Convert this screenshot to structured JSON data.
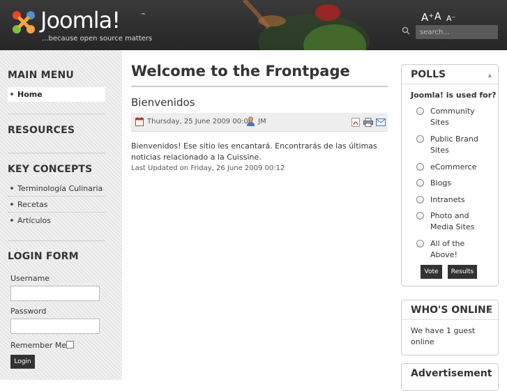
{
  "header": {
    "logo_text": "Joomla!",
    "logo_tm": "™",
    "tagline": "...because open source matters",
    "font_bigger": "A⁺",
    "font_reset": "A",
    "font_smaller": "A⁻",
    "search_placeholder": "search..."
  },
  "sidebar": {
    "main_menu": {
      "title": "MAIN MENU",
      "items": [
        {
          "label": "Home",
          "active": true
        }
      ]
    },
    "resources": {
      "title": "RESOURCES"
    },
    "key_concepts": {
      "title": "KEY CONCEPTS",
      "items": [
        {
          "label": "Terminología Culinaria"
        },
        {
          "label": "Recetas"
        },
        {
          "label": "Artículos"
        }
      ]
    },
    "login_form": {
      "title": "LOGIN FORM",
      "username_label": "Username",
      "username_value": "",
      "password_label": "Password",
      "password_value": "",
      "remember_label": "Remember Me",
      "remember_checked": false,
      "login_label": "Login"
    }
  },
  "main": {
    "page_title": "Welcome to the Frontpage",
    "article": {
      "title": "Bienvenidos",
      "date": "Thursday, 25 June 2009 00:00",
      "author": "JM",
      "body": "Bienvenidos! Ese sitio les encantará.  Encontrarás de las últimas noticias relacionado a la Cuissine.",
      "last_updated": "Last Updated on Friday, 26 June 2009 00:12"
    }
  },
  "right": {
    "polls": {
      "title": "POLLS",
      "toggle": "▲",
      "question": "Joomla! is used for?",
      "options": [
        {
          "label": "Community Sites"
        },
        {
          "label": "Public Brand Sites"
        },
        {
          "label": "eCommerce"
        },
        {
          "label": "Blogs"
        },
        {
          "label": "Intranets"
        },
        {
          "label": "Photo and Media Sites"
        },
        {
          "label": "All of the Above!"
        }
      ],
      "vote_label": "Vote",
      "results_label": "Results"
    },
    "whos_online": {
      "title": "WHO'S ONLINE",
      "toggle": "▲",
      "text": "We have 1 guest online"
    },
    "advertisement": {
      "title": "Advertisement"
    }
  },
  "colors": {
    "header_bg": "#2b2b2b",
    "button_bg": "#333333",
    "sidebar_bg": "#eeeeee"
  }
}
